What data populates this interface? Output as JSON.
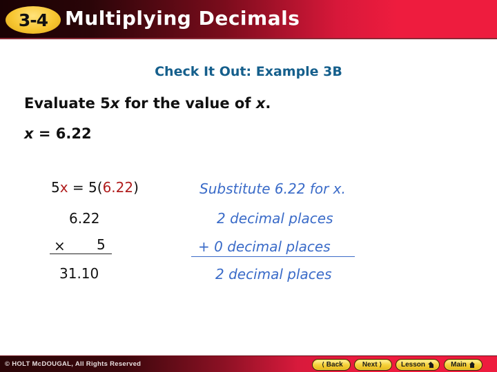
{
  "header": {
    "lesson_number": "3-4",
    "title": "Multiplying Decimals",
    "colors": {
      "badge": "#f7c631",
      "bar_right": "#ee1c3e",
      "bar_left": "#1a0204"
    }
  },
  "slide": {
    "subtitle": "Check It Out: Example 3B",
    "prompt": {
      "before": "Evaluate 5",
      "var": "x",
      "middle": " for the value of ",
      "var2": "x",
      "after": "."
    },
    "given": {
      "var": "x",
      "rest": " = 6.22"
    },
    "steps": {
      "substitution": {
        "lhs_coef": "5",
        "lhs_var": "x",
        "eq": " = 5(",
        "value": "6.22",
        "close": ")"
      },
      "substitution_note": "Substitute 6.22 for x.",
      "factor1": "6.22",
      "factor1_note": "2 decimal places",
      "times_sign": "×",
      "factor2": "5",
      "factor2_note": "+ 0 decimal places",
      "product": "31.10",
      "product_note": "2 decimal places"
    },
    "colors": {
      "subtitle": "#155f8c",
      "notes": "#3a6bc8",
      "highlight": "#b01c1c"
    }
  },
  "footer": {
    "copyright": "© HOLT McDOUGAL, All Rights Reserved",
    "buttons": [
      {
        "label": "Back",
        "icon": "chevron-left-icon"
      },
      {
        "label": "Next",
        "icon": "chevron-right-icon"
      },
      {
        "label": "Lesson",
        "icon": "home-icon"
      },
      {
        "label": "Main",
        "icon": "home-icon"
      }
    ]
  }
}
